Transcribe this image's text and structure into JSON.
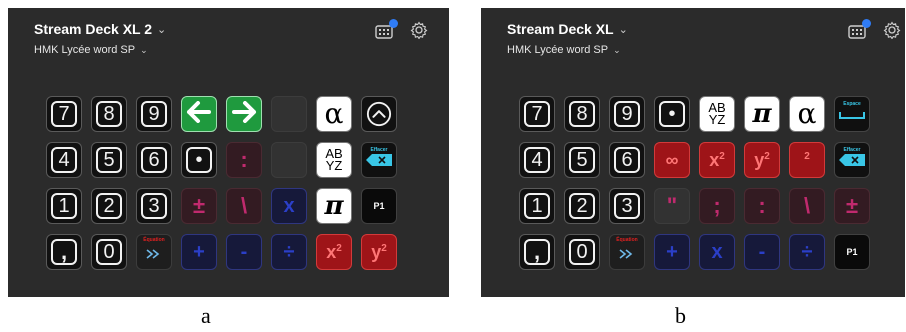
{
  "panel_a": {
    "device_name": "Stream Deck XL 2",
    "profile": "HMK Lycée word SP",
    "keys": [
      {
        "type": "num",
        "label": "7"
      },
      {
        "type": "num",
        "label": "8"
      },
      {
        "type": "num",
        "label": "9"
      },
      {
        "type": "green",
        "icon": "arrow-left-icon"
      },
      {
        "type": "green",
        "icon": "arrow-right-icon"
      },
      {
        "type": "empty"
      },
      {
        "type": "white",
        "label": "α",
        "cls": "bigsym"
      },
      {
        "type": "num",
        "icon": "chevron-up-circle-icon"
      },
      {
        "type": "num",
        "label": "4"
      },
      {
        "type": "num",
        "label": "5"
      },
      {
        "type": "num",
        "label": "6"
      },
      {
        "type": "num",
        "label": "•"
      },
      {
        "type": "dark-ruby",
        "label": ":"
      },
      {
        "type": "empty"
      },
      {
        "type": "white",
        "label": "AB YZ",
        "cls": "abyz"
      },
      {
        "type": "cyan",
        "label": "Effacer",
        "icon": "backspace-icon"
      },
      {
        "type": "num",
        "label": "1"
      },
      {
        "type": "num",
        "label": "2"
      },
      {
        "type": "num",
        "label": "3"
      },
      {
        "type": "dark-ruby",
        "label": "±"
      },
      {
        "type": "dark-ruby",
        "label": "\\"
      },
      {
        "type": "navy",
        "label": "x"
      },
      {
        "type": "white",
        "label": "π",
        "cls": "pi"
      },
      {
        "type": "black",
        "label": "P1"
      },
      {
        "type": "num",
        "label": ","
      },
      {
        "type": "num",
        "label": "0"
      },
      {
        "type": "eq",
        "label": "Équation",
        "icon": "double-chevron-icon"
      },
      {
        "type": "navy",
        "label": "+"
      },
      {
        "type": "navy",
        "label": "-"
      },
      {
        "type": "navy",
        "label": "÷"
      },
      {
        "type": "red",
        "label": "x",
        "sup": "2"
      },
      {
        "type": "red",
        "label": "y",
        "sup": "2"
      }
    ]
  },
  "panel_b": {
    "device_name": "Stream Deck XL",
    "profile": "HMK Lycée word SP",
    "keys": [
      {
        "type": "num",
        "label": "7"
      },
      {
        "type": "num",
        "label": "8"
      },
      {
        "type": "num",
        "label": "9"
      },
      {
        "type": "num",
        "label": "•"
      },
      {
        "type": "white",
        "label": "AB YZ",
        "cls": "abyz"
      },
      {
        "type": "white",
        "label": "π",
        "cls": "pi"
      },
      {
        "type": "white",
        "label": "α",
        "cls": "bigsym"
      },
      {
        "type": "cyan",
        "label": "Espace",
        "icon": "space-bar-icon"
      },
      {
        "type": "num",
        "label": "4"
      },
      {
        "type": "num",
        "label": "5"
      },
      {
        "type": "num",
        "label": "6"
      },
      {
        "type": "red",
        "label": "∞"
      },
      {
        "type": "red",
        "label": "x",
        "sup": "2"
      },
      {
        "type": "red",
        "label": "y",
        "sup": "2"
      },
      {
        "type": "red",
        "label": "",
        "sup": "2"
      },
      {
        "type": "cyan",
        "label": "Effacer",
        "icon": "backspace-icon"
      },
      {
        "type": "num",
        "label": "1"
      },
      {
        "type": "num",
        "label": "2"
      },
      {
        "type": "num",
        "label": "3"
      },
      {
        "type": "empty",
        "label": "\""
      },
      {
        "type": "dark-ruby",
        "label": ";"
      },
      {
        "type": "dark-ruby",
        "label": ":"
      },
      {
        "type": "dark-ruby",
        "label": "\\"
      },
      {
        "type": "dark-ruby",
        "label": "±"
      },
      {
        "type": "num",
        "label": ","
      },
      {
        "type": "num",
        "label": "0"
      },
      {
        "type": "eq",
        "label": "Équation",
        "icon": "double-chevron-icon"
      },
      {
        "type": "navy",
        "label": "+"
      },
      {
        "type": "navy",
        "label": "x"
      },
      {
        "type": "navy",
        "label": "-"
      },
      {
        "type": "navy",
        "label": "÷"
      },
      {
        "type": "black",
        "label": "P1"
      }
    ]
  },
  "captions": {
    "a": "a",
    "b": "b"
  }
}
